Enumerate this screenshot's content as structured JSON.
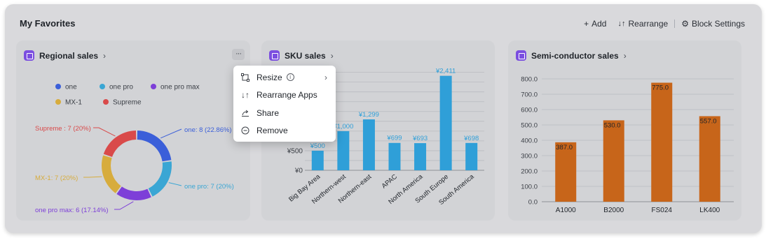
{
  "page": {
    "title": "My Favorites"
  },
  "toolbar": {
    "add": "Add",
    "rearrange": "Rearrange",
    "settings": "Block Settings"
  },
  "cards": [
    {
      "title": "Regional sales",
      "icon": "app-icon"
    },
    {
      "title": "SKU sales",
      "icon": "app-icon"
    },
    {
      "title": "Semi-conductor sales",
      "icon": "app-icon"
    }
  ],
  "menu": {
    "items": [
      {
        "label": "Resize",
        "icon": "resize-icon"
      },
      {
        "label": "Rearrange Apps",
        "icon": "sort-icon"
      },
      {
        "label": "Share",
        "icon": "share-icon"
      },
      {
        "label": "Remove",
        "icon": "remove-icon"
      }
    ]
  },
  "colors": {
    "panel": "#d9d9dc",
    "card": "#d2d3d6",
    "brand": "#7b4ee0",
    "sku_bar": "#2f9fd8",
    "semi_bar": "#c7651a"
  },
  "chart_data": [
    {
      "type": "pie",
      "variant": "donut",
      "title": "",
      "categories": [
        "one",
        "one pro",
        "one pro max",
        "MX-1",
        "Supreme"
      ],
      "values": [
        8,
        7,
        6,
        7,
        7
      ],
      "labels": [
        "one: 8 (22.86%)",
        "one pro: 7 (20%)",
        "one pro max: 6 (17.14%)",
        "MX-1: 7 (20%)",
        "Supreme : 7 (20%)"
      ],
      "colors": [
        "#3b5fd9",
        "#3aa6d4",
        "#7d3fd8",
        "#d7ac3d",
        "#d94a4a"
      ],
      "legend": "top"
    },
    {
      "type": "bar",
      "title": "",
      "categories": [
        "Big Bay Area",
        "Northern-west",
        "Northern-east",
        "APAC",
        "North America",
        "South Europe",
        "South America"
      ],
      "values": [
        500,
        1000,
        1299,
        699,
        693,
        2411,
        698
      ],
      "value_labels": [
        "¥500",
        "¥1,000",
        "¥1,299",
        "¥699",
        "¥693",
        "¥2,411",
        "¥698"
      ],
      "yticks": [
        "¥0",
        "¥500"
      ],
      "ylim": [
        0,
        2600
      ],
      "grid": true
    },
    {
      "type": "bar",
      "title": "",
      "categories": [
        "A1000",
        "B2000",
        "FS024",
        "LK400"
      ],
      "values": [
        387.0,
        530.0,
        775.0,
        557.0
      ],
      "value_labels": [
        "387.0",
        "530.0",
        "775.0",
        "557.0"
      ],
      "yticks": [
        "0.0",
        "100.0",
        "200.0",
        "300.0",
        "400.0",
        "500.0",
        "600.0",
        "700.0",
        "800.0"
      ],
      "ylim": [
        0,
        800
      ],
      "grid": true
    }
  ]
}
